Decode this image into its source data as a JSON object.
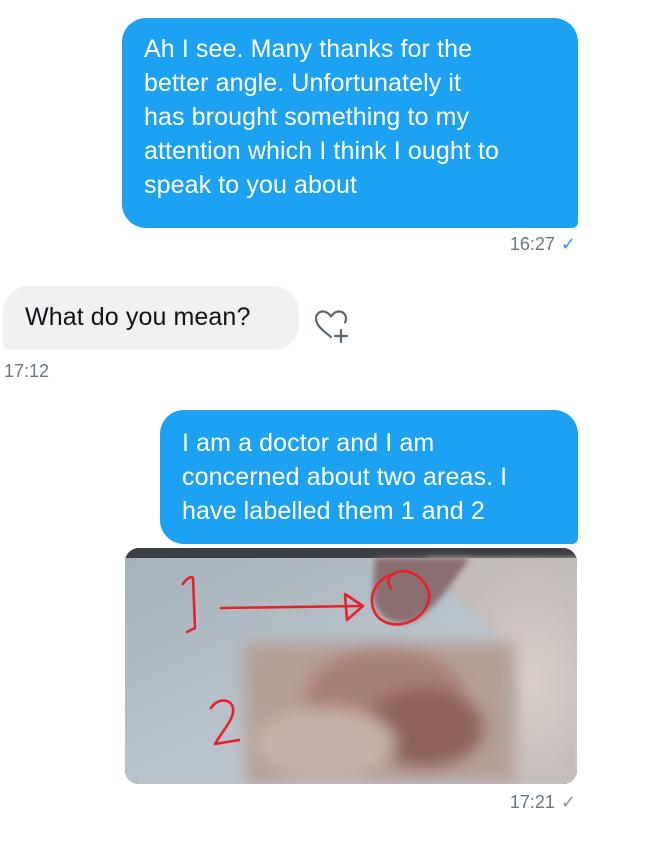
{
  "messages": [
    {
      "direction": "outgoing",
      "lines": [
        "Ah I see. Many thanks for the",
        "better angle. Unfortunately it",
        "has brought something to my",
        "attention which I think I ought to",
        "speak to you about"
      ],
      "time": "16:27",
      "status_icon": "check-icon"
    },
    {
      "direction": "incoming",
      "lines": [
        "What do you mean?"
      ],
      "time": "17:12",
      "reaction_icon": "heart-plus-icon"
    },
    {
      "direction": "outgoing",
      "lines": [
        "I am a doctor and I am",
        "concerned about two areas. I",
        "have labelled them 1 and 2"
      ]
    },
    {
      "direction": "outgoing",
      "type": "image",
      "image_annotations": [
        "1",
        "2"
      ],
      "time": "17:21",
      "status_icon": "check-icon"
    }
  ],
  "colors": {
    "outgoing_bubble": "#1da1f2",
    "incoming_bubble": "#eff1f3",
    "annotation_red": "#e8202a",
    "timestamp": "#6b7780"
  }
}
